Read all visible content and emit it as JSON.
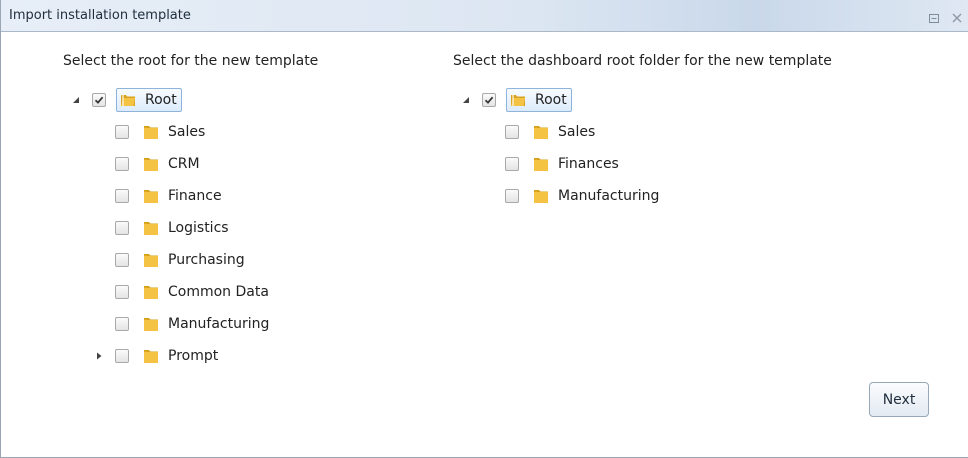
{
  "window": {
    "title": "Import installation template",
    "controls": {
      "restore_icon": "restore-icon",
      "close_icon": "close-icon"
    }
  },
  "colors": {
    "folder": "#f5c344",
    "folder_dark": "#d9a21f",
    "selection_border": "#8fb4dc",
    "title_gradient_mid": "#c9d8ea"
  },
  "left_panel": {
    "heading": "Select the root for the new template",
    "root": {
      "label": "Root",
      "checked": true,
      "expanded": true
    },
    "children": [
      {
        "label": "Sales",
        "checked": false,
        "has_children": false
      },
      {
        "label": "CRM",
        "checked": false,
        "has_children": false
      },
      {
        "label": "Finance",
        "checked": false,
        "has_children": false
      },
      {
        "label": "Logistics",
        "checked": false,
        "has_children": false
      },
      {
        "label": "Purchasing",
        "checked": false,
        "has_children": false
      },
      {
        "label": "Common Data",
        "checked": false,
        "has_children": false
      },
      {
        "label": "Manufacturing",
        "checked": false,
        "has_children": false
      },
      {
        "label": "Prompt",
        "checked": false,
        "has_children": true
      }
    ]
  },
  "right_panel": {
    "heading": "Select the dashboard root folder for the new template",
    "root": {
      "label": "Root",
      "checked": true,
      "expanded": true
    },
    "children": [
      {
        "label": "Sales",
        "checked": false,
        "has_children": false
      },
      {
        "label": "Finances",
        "checked": false,
        "has_children": false
      },
      {
        "label": "Manufacturing",
        "checked": false,
        "has_children": false
      }
    ]
  },
  "footer": {
    "next_label": "Next"
  }
}
